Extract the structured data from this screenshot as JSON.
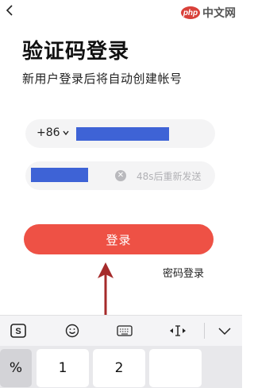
{
  "header": {
    "back_icon": "chevron-left-icon"
  },
  "watermark": {
    "logo_text": "php",
    "site_text": "中文网"
  },
  "page": {
    "title": "验证码登录",
    "subtitle": "新用户登录后将自动创建帐号"
  },
  "phone_field": {
    "country_code": "+86",
    "value_redacted": true
  },
  "code_field": {
    "value_redacted": true,
    "resend_label": "48s后重新发送",
    "clear_icon": "clear-icon"
  },
  "login_button": {
    "label": "登录",
    "color": "#ee5145"
  },
  "password_login": {
    "label": "密码登录"
  },
  "keyboard": {
    "toolbar": [
      "sogou-logo-icon",
      "emoji-icon",
      "keyboard-icon",
      "cursor-move-icon",
      "collapse-keyboard-icon"
    ],
    "keys": [
      "%",
      "1",
      "2"
    ]
  }
}
